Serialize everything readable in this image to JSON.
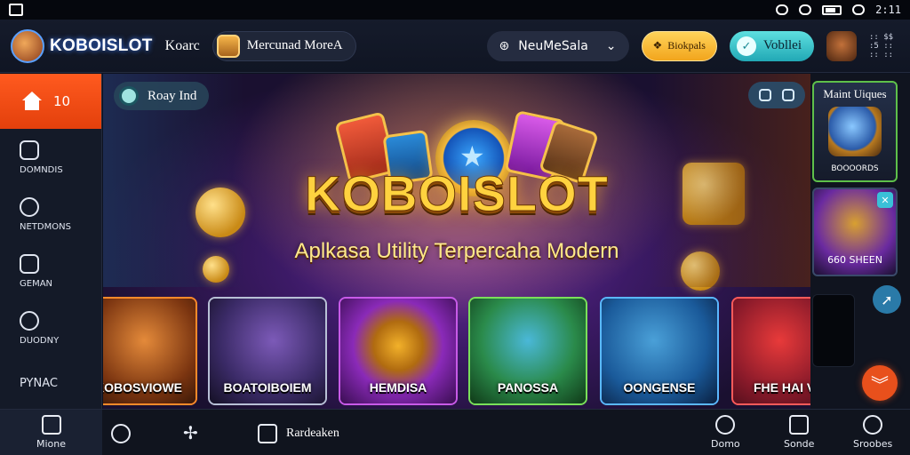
{
  "statusbar": {
    "time": "2:11"
  },
  "header": {
    "brand": "KOBOISLOT",
    "nav_link": "Koarc",
    "promo_pill": "Mercunad MoreA",
    "dropdown": "NeuMeSala",
    "yellow_button": "Biokpals",
    "teal_button": "Vobllei",
    "code_text": ":: $$\n:5 ::\n:: ::"
  },
  "sidebar": {
    "home_label": "10",
    "items": [
      {
        "label": "DOMNDIS",
        "icon": "chat-icon"
      },
      {
        "label": "NETDMONS",
        "icon": "clock-icon"
      },
      {
        "label": "GEMAN",
        "icon": "share-icon"
      },
      {
        "label": "DUODNY",
        "icon": "chat-bubble-icon"
      },
      {
        "label": "PYNAC",
        "icon": "grid-icon"
      }
    ]
  },
  "hero": {
    "chip_label": "Roay Ind",
    "title": "KOBOISLOT",
    "subtitle": "Aplkasa Utility Terpercaha Modern"
  },
  "games": [
    {
      "label": "KOBOSVIOWE",
      "color": "#ff8a2a"
    },
    {
      "label": "BOATOIBOIEM",
      "color": "#b8c0d6"
    },
    {
      "label": "HEMDISA",
      "color": "#c85ae8"
    },
    {
      "label": "PANOSSA",
      "color": "#7ae05a"
    },
    {
      "label": "OONGENSE",
      "color": "#5ab8ff"
    },
    {
      "label": "FHE HAI VIO",
      "color": "#ff5a5a"
    }
  ],
  "right_panel": {
    "card1_title": "Maint Uiques",
    "card1_label": "BOOOORDS",
    "card2_label": "660 SHEEN"
  },
  "bottombar": {
    "home_label": "Mione",
    "center_label": "Rardeaken",
    "right_items": [
      "Domo",
      "Sonde",
      "Sroobes"
    ]
  }
}
